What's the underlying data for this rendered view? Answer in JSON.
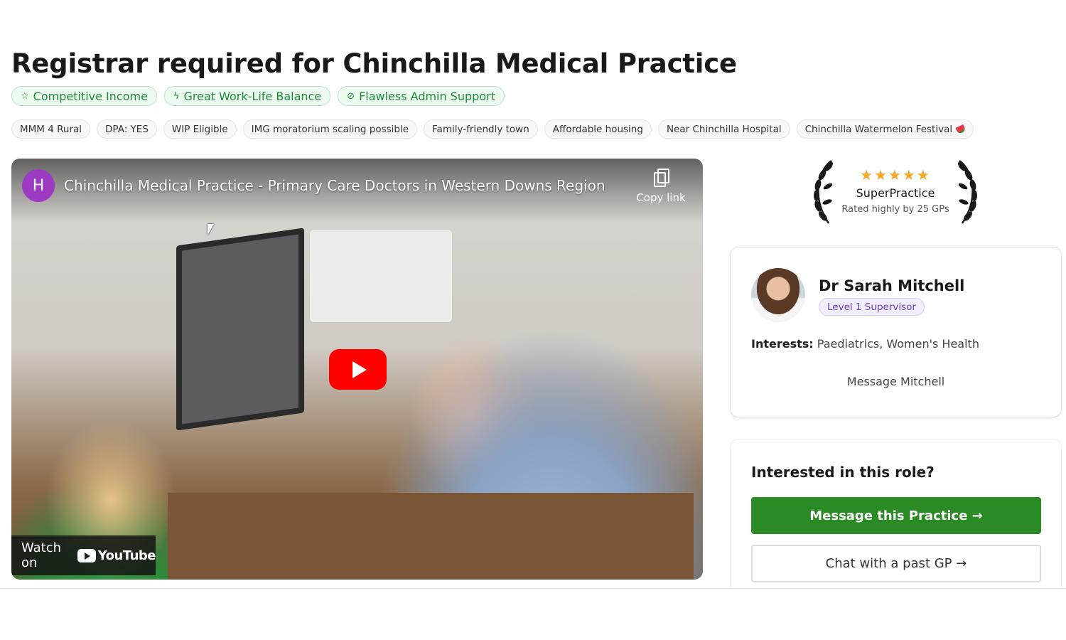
{
  "header": {
    "title": "Registrar required for Chinchilla Medical Practice"
  },
  "highlights": [
    {
      "label": "Competitive Income",
      "icon": "star-outline-icon"
    },
    {
      "label": "Great Work-Life Balance",
      "icon": "lightning-icon"
    },
    {
      "label": "Flawless Admin Support",
      "icon": "check-circle-icon"
    }
  ],
  "tags": [
    "MMM 4 Rural",
    "DPA: YES",
    "WIP Eligible",
    "IMG moratorium scaling possible",
    "Family-friendly town",
    "Affordable housing",
    "Near Chinchilla Hospital",
    "Chinchilla Watermelon Festival"
  ],
  "video": {
    "channel_initial": "H",
    "title": "Chinchilla Medical Practice - Primary Care Doctors in Western Downs Region",
    "copy_link": "Copy link",
    "watch_on": "Watch on",
    "youtube": "YouTube"
  },
  "award": {
    "stars": "★★★★★",
    "title": "SuperPractice",
    "subtitle": "Rated highly by 25 GPs"
  },
  "supervisor": {
    "name": "Dr Sarah Mitchell",
    "level": "Level 1 Supervisor",
    "interests_label": "Interests:",
    "interests": "Paediatrics, Women's Health",
    "message": "Message Mitchell"
  },
  "interest": {
    "title": "Interested in this role?",
    "primary_button": "Message this Practice →",
    "secondary_button": "Chat with a past GP →"
  },
  "colors": {
    "highlight_green": "#1d8a3a",
    "primary_button": "#2a8a24",
    "badge_purple": "#6b3fd1",
    "star_gold": "#f5a623",
    "youtube_red": "#ff0000"
  }
}
